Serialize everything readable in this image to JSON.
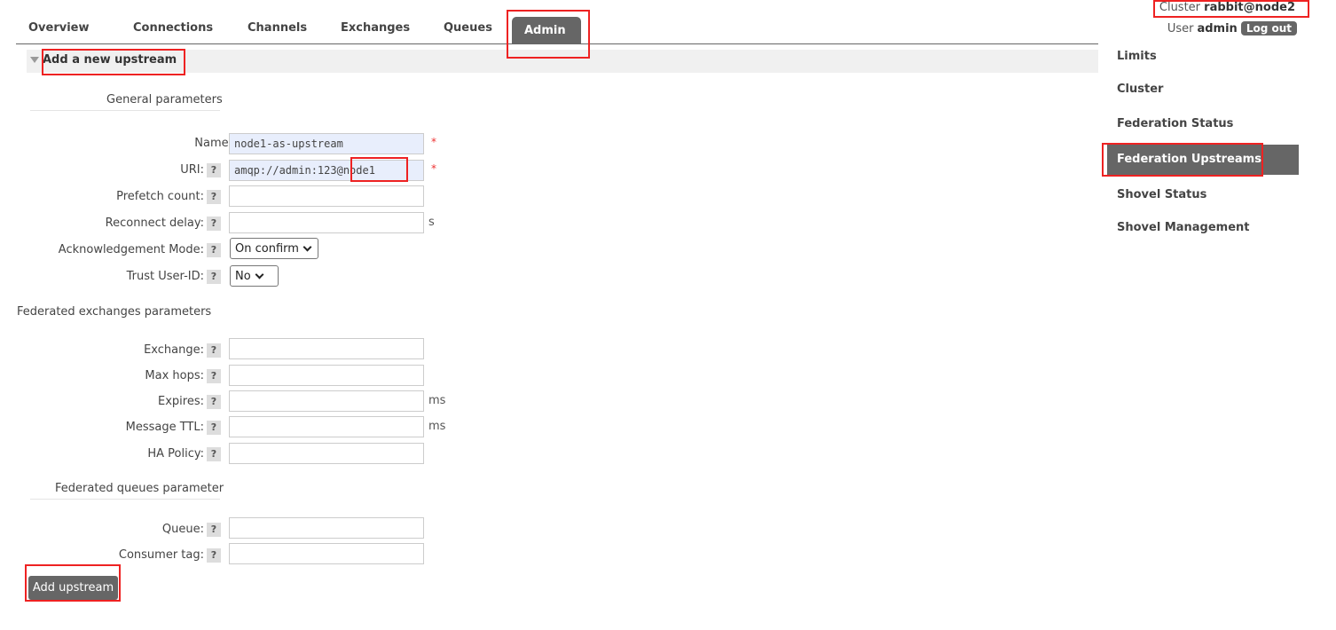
{
  "nav": {
    "tabs": [
      {
        "label": "Overview"
      },
      {
        "label": "Connections"
      },
      {
        "label": "Channels"
      },
      {
        "label": "Exchanges"
      },
      {
        "label": "Queues"
      },
      {
        "label": "Admin",
        "active": true
      }
    ]
  },
  "top_info": {
    "cluster_label": "Cluster",
    "cluster_name": "rabbit@node2",
    "user_label": "User",
    "user_name": "admin",
    "logout_label": "Log out"
  },
  "section": {
    "title": "Add a new upstream"
  },
  "general": {
    "title": "General parameters",
    "name_label": "Name:",
    "name_value": "node1-as-upstream",
    "uri_label": "URI:",
    "uri_value": "amqp://admin:123@node1",
    "prefetch_label": "Prefetch count:",
    "prefetch_value": "",
    "reconnect_label": "Reconnect delay:",
    "reconnect_value": "",
    "reconnect_unit": "s",
    "ack_label": "Acknowledgement Mode:",
    "ack_selected": "On confirm",
    "trust_label": "Trust User-ID:",
    "trust_selected": "No",
    "required_mark": "*",
    "help_mark": "?"
  },
  "exchanges": {
    "title": "Federated exchanges parameters",
    "exchange_label": "Exchange:",
    "exchange_value": "",
    "maxhops_label": "Max hops:",
    "maxhops_value": "",
    "expires_label": "Expires:",
    "expires_value": "",
    "expires_unit": "ms",
    "ttl_label": "Message TTL:",
    "ttl_value": "",
    "ttl_unit": "ms",
    "ha_label": "HA Policy:",
    "ha_value": ""
  },
  "queues": {
    "title": "Federated queues parameter",
    "queue_label": "Queue:",
    "queue_value": "",
    "consumer_label": "Consumer tag:",
    "consumer_value": ""
  },
  "add_button_label": "Add upstream",
  "right_menu": {
    "items": [
      {
        "label": "Limits"
      },
      {
        "label": "Cluster"
      },
      {
        "label": "Federation Status"
      },
      {
        "label": "Federation Upstreams",
        "active": true
      },
      {
        "label": "Shovel Status"
      },
      {
        "label": "Shovel Management"
      }
    ]
  },
  "colors": {
    "accent": "#666666",
    "annotation": "#ee2222",
    "required": "#ee3333"
  }
}
